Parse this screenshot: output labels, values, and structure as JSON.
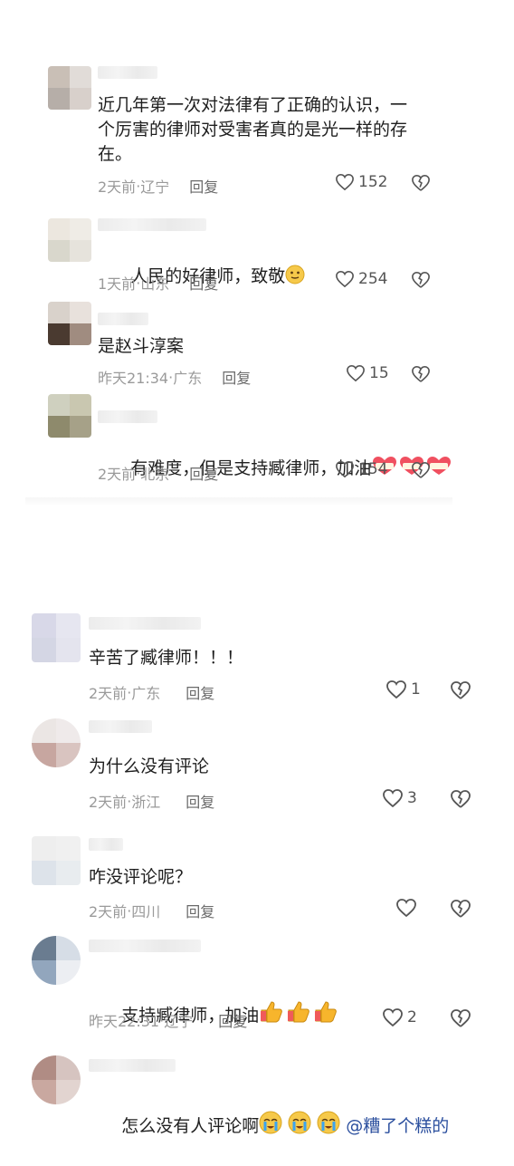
{
  "colors": {
    "text": "#1f1f1f",
    "meta": "#9a9a9a",
    "reply": "#6a6a6a",
    "mention": "#2b4f9e"
  },
  "comments_top": [
    {
      "text": "近几年第一次对法律有了正确的认识，一\n个厉害的律师对受害者真的是光一样的存\n在。",
      "time": "2天前",
      "location": "辽宁",
      "reply": "回复",
      "likes": "152"
    },
    {
      "text": "人民的好律师，致敬",
      "emoji": "slightly-smiling-face-icon",
      "time": "1天前",
      "location": "山东",
      "reply": "回复",
      "likes": "254"
    },
    {
      "text": "是赵斗淳案",
      "time": "昨天21:34",
      "location": "广东",
      "reply": "回复",
      "likes": "15"
    },
    {
      "text": "有难度，但是支持臧律师，加油",
      "emoji": "jiayou-heart-sticker-icon",
      "time": "2天前",
      "location": "北京",
      "reply": "回复",
      "likes": "154"
    }
  ],
  "comments_bottom": [
    {
      "text": "辛苦了臧律师！！！",
      "time": "2天前",
      "location": "广东",
      "reply": "回复",
      "likes": "1"
    },
    {
      "text": "为什么没有评论",
      "time": "2天前",
      "location": "浙江",
      "reply": "回复",
      "likes": "3"
    },
    {
      "text": "咋没评论呢？",
      "time": "2天前",
      "location": "四川",
      "reply": "回复",
      "likes": ""
    },
    {
      "text": "支持臧律师，加油",
      "emoji": "thumbs-up-icon",
      "time": "昨天22:31",
      "location": "辽宁",
      "reply": "回复",
      "likes": "2"
    },
    {
      "text": "怎么没有人评论啊",
      "emoji": "crying-face-icon",
      "mention": "@糟了个糕的"
    }
  ],
  "meta_separator": " · "
}
